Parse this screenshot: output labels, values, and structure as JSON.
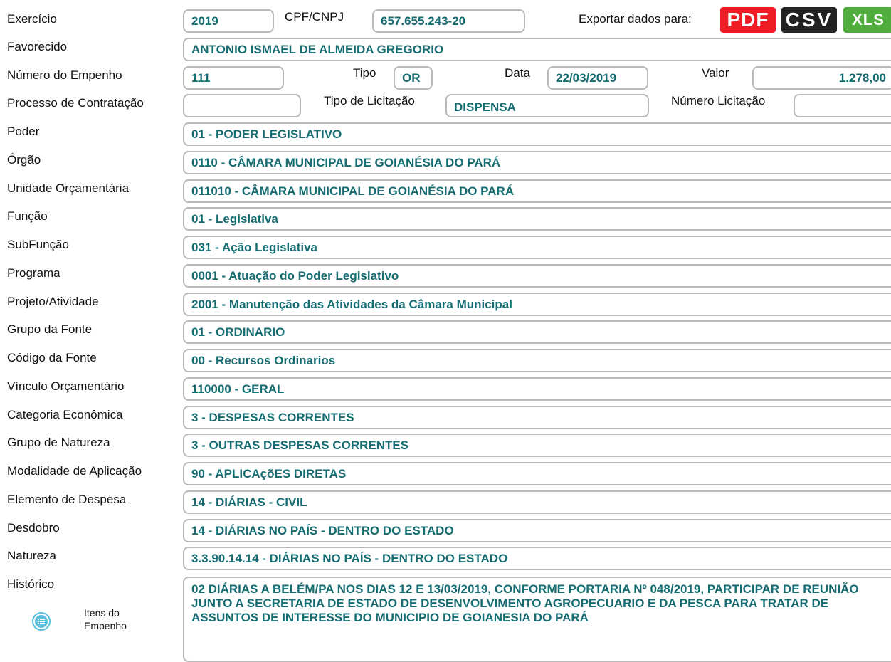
{
  "export": {
    "label": "Exportar dados para:",
    "pdf": "PDF",
    "csv": "CSV",
    "xls": "XLS"
  },
  "header": {
    "exercicio_label": "Exercício",
    "exercicio": "2019",
    "cpf_label": "CPF/CNPJ",
    "cpf": "657.655.243-20",
    "favorecido_label": "Favorecido",
    "favorecido": "ANTONIO ISMAEL DE ALMEIDA GREGORIO",
    "empenho_label": "Número do Empenho",
    "empenho": "111",
    "tipo_label": "Tipo",
    "tipo": "OR",
    "data_label": "Data",
    "data": "22/03/2019",
    "valor_label": "Valor",
    "valor": "1.278,00",
    "processo_label": "Processo de Contratação",
    "processo": "",
    "tipo_licitacao_label": "Tipo de Licitação",
    "tipo_licitacao": "DISPENSA",
    "numero_licitacao_label": "Número Licitação",
    "numero_licitacao": ""
  },
  "rows": [
    {
      "label": "Poder",
      "value": "01 - PODER LEGISLATIVO"
    },
    {
      "label": "Órgão",
      "value": "0110 - CÂMARA MUNICIPAL DE GOIANÉSIA DO PARÁ"
    },
    {
      "label": "Unidade Orçamentária",
      "value": "011010 - CÂMARA MUNICIPAL DE GOIANÉSIA DO PARÁ"
    },
    {
      "label": "Função",
      "value": "01 - Legislativa"
    },
    {
      "label": "SubFunção",
      "value": "031 - Ação Legislativa"
    },
    {
      "label": "Programa",
      "value": "0001 - Atuação do Poder Legislativo"
    },
    {
      "label": "Projeto/Atividade",
      "value": "2001 - Manutenção das Atividades da Câmara Municipal"
    },
    {
      "label": "Grupo da Fonte",
      "value": "01 - ORDINARIO"
    },
    {
      "label": "Código da Fonte",
      "value": "00 - Recursos Ordinarios"
    },
    {
      "label": "Vínculo Orçamentário",
      "value": "110000 - GERAL"
    },
    {
      "label": "Categoria Econômica",
      "value": "3 - DESPESAS CORRENTES"
    },
    {
      "label": "Grupo de Natureza",
      "value": "3 - OUTRAS DESPESAS CORRENTES"
    },
    {
      "label": "Modalidade de Aplicação",
      "value": "90 - APLICAçõES DIRETAS"
    },
    {
      "label": "Elemento de Despesa",
      "value": "14 - DIÁRIAS - CIVIL"
    },
    {
      "label": "Desdobro",
      "value": "14 - DIÁRIAS NO PAÍS - DENTRO DO ESTADO"
    },
    {
      "label": "Natureza",
      "value": "3.3.90.14.14 - DIÁRIAS NO PAÍS - DENTRO DO ESTADO"
    }
  ],
  "historico": {
    "label": "Histórico",
    "value": "02 DIÁRIAS A BELÉM/PA NOS DIAS 12 E 13/03/2019, CONFORME PORTARIA Nº 048/2019, PARTICIPAR DE REUNIÃO JUNTO A SECRETARIA DE ESTADO DE DESENVOLVIMENTO AGROPECUARIO E DA PESCA PARA TRATAR DE ASSUNTOS DE INTERESSE DO MUNICIPIO DE GOIANESIA DO PARÁ"
  },
  "itens": {
    "line1": "Itens do",
    "line2": "Empenho",
    "icon": "list-icon",
    "icon_color": "#5bc0de"
  },
  "colors": {
    "value_text": "#156c71",
    "border": "#b9b9b9",
    "pdf": "#ee1c25",
    "csv": "#222222",
    "xls": "#4fae3b"
  }
}
